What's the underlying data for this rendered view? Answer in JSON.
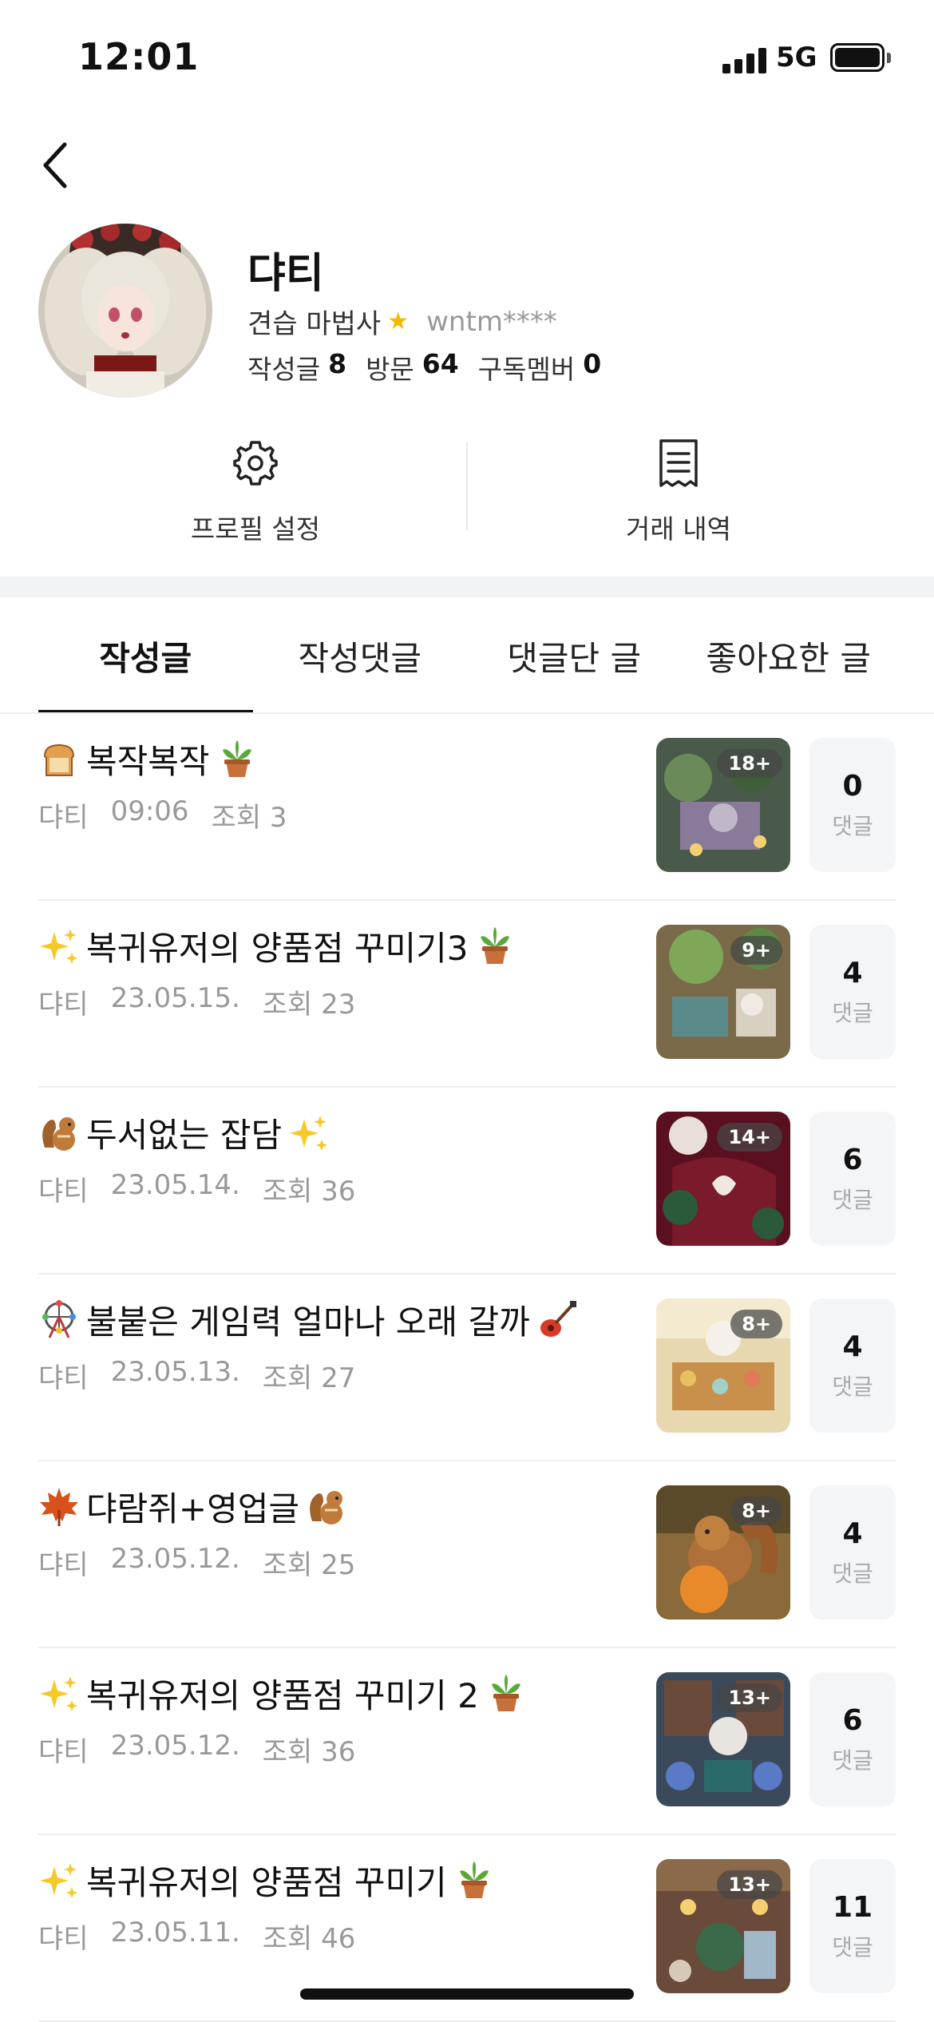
{
  "status_bar": {
    "time": "12:01",
    "network": "5G"
  },
  "profile": {
    "nickname": "댜티",
    "level": "견습 마법사",
    "user_id": "wntm****",
    "posts_label": "작성글",
    "posts_count": "8",
    "visits_label": "방문",
    "visits_count": "64",
    "members_label": "구독멤버",
    "members_count": "0"
  },
  "actions": {
    "settings": "프로필 설정",
    "trade": "거래 내역"
  },
  "tabs": [
    "작성글",
    "작성댓글",
    "댓글단 글",
    "좋아요한 글"
  ],
  "posts": [
    {
      "title": "복작복작",
      "author": "댜티",
      "date": "09:06",
      "views": "조회 3",
      "badge": "18+",
      "comments": "0",
      "comments_label": "댓글",
      "emoji_before": "bread-icon",
      "emoji_after": "potted-plant-icon"
    },
    {
      "title": "복귀유저의 양품점 꾸미기3",
      "author": "댜티",
      "date": "23.05.15.",
      "views": "조회 23",
      "badge": "9+",
      "comments": "4",
      "comments_label": "댓글",
      "emoji_before": "sparkles-icon",
      "emoji_after": "potted-plant-icon"
    },
    {
      "title": "두서없는 잡담",
      "author": "댜티",
      "date": "23.05.14.",
      "views": "조회 36",
      "badge": "14+",
      "comments": "6",
      "comments_label": "댓글",
      "emoji_before": "chipmunk-icon",
      "emoji_after": "sparkles-icon"
    },
    {
      "title": "불붙은 게임력 얼마나 오래 갈까",
      "author": "댜티",
      "date": "23.05.13.",
      "views": "조회 27",
      "badge": "8+",
      "comments": "4",
      "comments_label": "댓글",
      "emoji_before": "ferris-wheel-icon",
      "emoji_after": "guitar-icon"
    },
    {
      "title": "댜람쥐+영업글",
      "author": "댜티",
      "date": "23.05.12.",
      "views": "조회 25",
      "badge": "8+",
      "comments": "4",
      "comments_label": "댓글",
      "emoji_before": "maple-leaf-icon",
      "emoji_after": "chipmunk-icon"
    },
    {
      "title": "복귀유저의 양품점 꾸미기 2",
      "author": "댜티",
      "date": "23.05.12.",
      "views": "조회 36",
      "badge": "13+",
      "comments": "6",
      "comments_label": "댓글",
      "emoji_before": "sparkles-icon",
      "emoji_after": "potted-plant-icon"
    },
    {
      "title": "복귀유저의 양품점 꾸미기",
      "author": "댜티",
      "date": "23.05.11.",
      "views": "조회 46",
      "badge": "13+",
      "comments": "11",
      "comments_label": "댓글",
      "emoji_before": "sparkles-icon",
      "emoji_after": "potted-plant-icon"
    }
  ],
  "colors": {
    "accent_star": "#f5b800",
    "divider": "#eeeeee",
    "muted_text": "#999999",
    "comment_box_bg": "#f4f5f7"
  }
}
